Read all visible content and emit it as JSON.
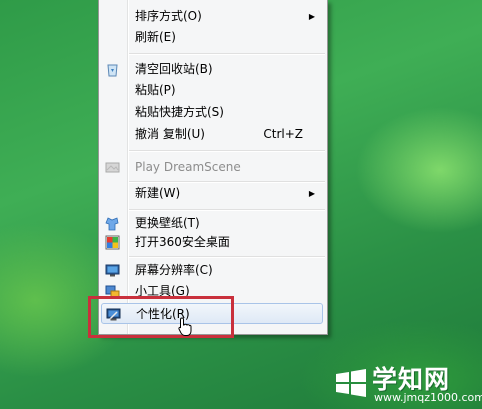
{
  "context_menu": {
    "items": [
      {
        "label": "排序方式(O)",
        "shortcut": "",
        "submenu": true,
        "icon": "",
        "disabled": false
      },
      {
        "label": "刷新(E)",
        "shortcut": "",
        "submenu": false,
        "icon": "",
        "disabled": false
      },
      {
        "label": "清空回收站(B)",
        "shortcut": "",
        "submenu": false,
        "icon": "recycle-bin-icon",
        "disabled": false
      },
      {
        "label": "粘贴(P)",
        "shortcut": "",
        "submenu": false,
        "icon": "",
        "disabled": false
      },
      {
        "label": "粘贴快捷方式(S)",
        "shortcut": "",
        "submenu": false,
        "icon": "",
        "disabled": false
      },
      {
        "label": "撤消 复制(U)",
        "shortcut": "Ctrl+Z",
        "submenu": false,
        "icon": "",
        "disabled": false
      },
      {
        "label": "Play DreamScene",
        "shortcut": "",
        "submenu": false,
        "icon": "dreamscene-icon",
        "disabled": true
      },
      {
        "label": "新建(W)",
        "shortcut": "",
        "submenu": true,
        "icon": "",
        "disabled": false
      },
      {
        "label": "更换壁纸(T)",
        "shortcut": "",
        "submenu": false,
        "icon": "wallpaper-icon",
        "disabled": false
      },
      {
        "label": "打开360安全桌面",
        "shortcut": "",
        "submenu": false,
        "icon": "360-desktop-icon",
        "disabled": false
      },
      {
        "label": "屏幕分辨率(C)",
        "shortcut": "",
        "submenu": false,
        "icon": "monitor-icon",
        "disabled": false
      },
      {
        "label": "小工具(G)",
        "shortcut": "",
        "submenu": false,
        "icon": "gadgets-icon",
        "disabled": false
      },
      {
        "label": "个性化(R)",
        "shortcut": "",
        "submenu": false,
        "icon": "personalize-icon",
        "disabled": false,
        "hovered": true
      }
    ]
  },
  "watermark": {
    "title": "学知网",
    "url": "www.jmqz1000.com"
  },
  "colors": {
    "highlight_border": "#c9303c",
    "menu_bg": "#f5f6f7"
  }
}
